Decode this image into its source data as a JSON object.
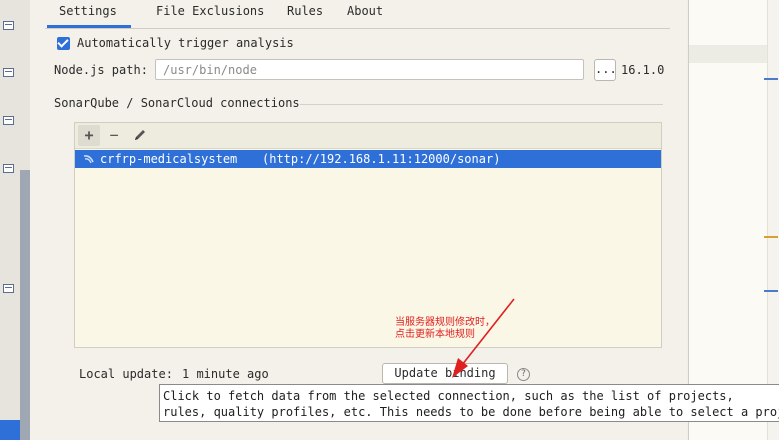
{
  "tabs": [
    {
      "label": "Settings",
      "active": true
    },
    {
      "label": "File Exclusions",
      "active": false
    },
    {
      "label": "Rules",
      "active": false
    },
    {
      "label": "About",
      "active": false
    }
  ],
  "auto_trigger": {
    "label": "Automatically trigger analysis",
    "checked": true
  },
  "node": {
    "label": "Node.js path:",
    "placeholder": "/usr/bin/node",
    "browse_label": "...",
    "version": "16.1.0"
  },
  "connections": {
    "title": "SonarQube / SonarCloud connections",
    "toolbar": {
      "add": "+",
      "remove": "−"
    },
    "items": [
      {
        "name": "crfrp-medicalsystem",
        "url": "(http://192.168.1.11:12000/sonar)",
        "selected": true
      }
    ]
  },
  "annotation": {
    "line1": "当服务器规则修改时，",
    "line2": "点击更新本地规则",
    "color": "#e02020"
  },
  "local_update": {
    "label": "Local update:",
    "value": "1 minute ago"
  },
  "update_binding": {
    "label": "Update binding"
  },
  "help": {
    "glyph": "?"
  },
  "tooltip": {
    "line1": "Click to fetch data from the selected connection, such as the list of projects,",
    "line2": "rules, quality profiles, etc. This needs to be done before being able to select a project."
  },
  "colors": {
    "accent": "#2e6fd8",
    "selection": "#2e6fd8",
    "annotation": "#e02020"
  },
  "icons": {
    "toolbar_edit": "pencil-icon",
    "connection": "sonar-icon",
    "help": "question-icon"
  }
}
